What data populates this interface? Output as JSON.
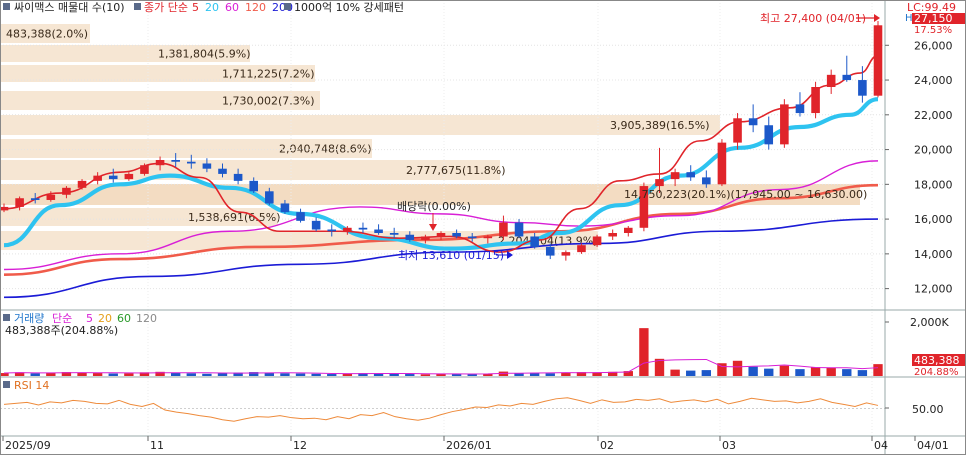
{
  "price_legend": {
    "symbol": "싸이맥스 매물대 수(10)",
    "ma_label": "종가 단순",
    "ma_periods": [
      {
        "label": "5",
        "color": "#e0242a"
      },
      {
        "label": "20",
        "color": "#2ec3f0"
      },
      {
        "label": "60",
        "color": "#d81fd6"
      },
      {
        "label": "120",
        "color": "#f05b4a"
      },
      {
        "label": "200",
        "color": "#1b1bd6"
      }
    ],
    "pattern_label": "1000억 10% 강세패턴"
  },
  "volume_legend": {
    "title": "거래량",
    "ma_label": "단순",
    "ma_periods": [
      {
        "label": "5",
        "color": "#d81fd6"
      },
      {
        "label": "20",
        "color": "#e6a11d"
      },
      {
        "label": "60",
        "color": "#2a9a2a"
      },
      {
        "label": "120",
        "color": "#8a8a8a"
      }
    ],
    "current_text": "483,388주(204.88%)"
  },
  "rsi_legend": {
    "title": "RSI 14"
  },
  "price_axis": {
    "ticks": [
      "26,000",
      "24,000",
      "22,000",
      "20,000",
      "18,000",
      "16,000",
      "14,000",
      "12,000"
    ],
    "lc_label": "LC:99.49",
    "h_label": "H",
    "current_price": "27,150",
    "current_change": "17.53%"
  },
  "volume_axis": {
    "top_label": "2,000K",
    "current_volume": "483,388",
    "current_ratio": "204.88%"
  },
  "rsi_axis": {
    "label": "50.00"
  },
  "date_axis": {
    "labels": [
      "2025/09",
      "11",
      "12",
      "2026/01",
      "02",
      "03",
      "04",
      "04/01"
    ]
  },
  "annotations": {
    "high": "최고 27,400 (04/01)",
    "low": "최저 13,610 (01/15)",
    "dividend": "배당락(0.00%)",
    "price_range": "14,750,223(20.1%)(17,945.00 ~ 16,630.00)"
  },
  "chart_data": [
    {
      "type": "candlestick",
      "name": "price",
      "ylim": [
        11000,
        27800
      ],
      "x_labels": [
        "2025/09",
        "11",
        "12",
        "2026/01",
        "02",
        "03",
        "04"
      ],
      "ohlc_sample": [
        [
          16500,
          16900,
          16400,
          16700
        ],
        [
          16700,
          17300,
          16500,
          17200
        ],
        [
          17200,
          17500,
          16900,
          17100
        ],
        [
          17100,
          17600,
          17000,
          17400
        ],
        [
          17400,
          17900,
          17200,
          17800
        ],
        [
          17800,
          18300,
          17700,
          18200
        ],
        [
          18200,
          18700,
          18000,
          18500
        ],
        [
          18500,
          18900,
          18100,
          18300
        ],
        [
          18300,
          18700,
          18200,
          18600
        ],
        [
          18600,
          19200,
          18500,
          19100
        ],
        [
          19100,
          19600,
          18800,
          19400
        ],
        [
          19400,
          19800,
          19000,
          19300
        ],
        [
          19300,
          19700,
          18900,
          19200
        ],
        [
          19200,
          19500,
          18700,
          18900
        ],
        [
          18900,
          19200,
          18400,
          18600
        ],
        [
          18600,
          18900,
          18000,
          18200
        ],
        [
          18200,
          18400,
          17500,
          17600
        ],
        [
          17600,
          17800,
          16800,
          16900
        ],
        [
          16900,
          17100,
          16300,
          16400
        ],
        [
          16400,
          16600,
          15800,
          15900
        ],
        [
          15900,
          16100,
          15300,
          15400
        ],
        [
          15400,
          15700,
          15000,
          15300
        ],
        [
          15300,
          15600,
          15100,
          15500
        ],
        [
          15500,
          15800,
          15200,
          15400
        ],
        [
          15400,
          15700,
          15100,
          15200
        ],
        [
          15200,
          15500,
          14900,
          15100
        ],
        [
          15100,
          15300,
          14700,
          14800
        ],
        [
          14800,
          15100,
          14600,
          15000
        ],
        [
          15000,
          15300,
          14800,
          15200
        ],
        [
          15200,
          15400,
          14900,
          15000
        ],
        [
          15000,
          15200,
          14700,
          14900
        ],
        [
          14900,
          15100,
          14600,
          15000
        ],
        [
          15000,
          16200,
          14800,
          15800
        ],
        [
          15800,
          16000,
          14900,
          15000
        ],
        [
          15000,
          15200,
          14300,
          14400
        ],
        [
          14400,
          14600,
          13700,
          13900
        ],
        [
          13900,
          14200,
          13610,
          14100
        ],
        [
          14100,
          14600,
          14000,
          14500
        ],
        [
          14500,
          15100,
          14400,
          15000
        ],
        [
          15000,
          15400,
          14800,
          15200
        ],
        [
          15200,
          15600,
          15000,
          15500
        ],
        [
          15500,
          18100,
          15300,
          17900
        ],
        [
          17900,
          20100,
          17500,
          18300
        ],
        [
          18300,
          18900,
          17900,
          18700
        ],
        [
          18700,
          19100,
          18200,
          18400
        ],
        [
          18400,
          18800,
          17800,
          18000
        ],
        [
          18000,
          20600,
          17900,
          20400
        ],
        [
          20400,
          22100,
          20000,
          21800
        ],
        [
          21800,
          22600,
          21000,
          21400
        ],
        [
          21400,
          21900,
          20000,
          20300
        ],
        [
          20300,
          22900,
          20100,
          22600
        ],
        [
          22600,
          23300,
          21900,
          22100
        ],
        [
          22100,
          23900,
          21800,
          23600
        ],
        [
          23600,
          24600,
          23200,
          24300
        ],
        [
          24300,
          25400,
          23900,
          24000
        ],
        [
          24000,
          24800,
          22700,
          23100
        ],
        [
          23100,
          27400,
          23000,
          27150
        ]
      ]
    },
    {
      "type": "bar",
      "name": "volume",
      "ylim": [
        0,
        2200000
      ],
      "values": [
        120000,
        150000,
        110000,
        130000,
        160000,
        140000,
        120000,
        100000,
        110000,
        150000,
        170000,
        130000,
        110000,
        90000,
        120000,
        140000,
        160000,
        130000,
        110000,
        100000,
        90000,
        80000,
        100000,
        120000,
        110000,
        90000,
        80000,
        70000,
        90000,
        100000,
        80000,
        90000,
        180000,
        120000,
        130000,
        110000,
        140000,
        160000,
        150000,
        170000,
        200000,
        1950000,
        700000,
        260000,
        220000,
        240000,
        520000,
        620000,
        380000,
        300000,
        420000,
        280000,
        360000,
        330000,
        280000,
        240000,
        483388
      ],
      "up": [
        true,
        true,
        false,
        true,
        true,
        true,
        true,
        false,
        true,
        true,
        true,
        false,
        false,
        false,
        false,
        false,
        false,
        false,
        false,
        false,
        false,
        false,
        true,
        false,
        false,
        false,
        false,
        true,
        true,
        false,
        false,
        true,
        true,
        false,
        false,
        false,
        true,
        true,
        true,
        true,
        true,
        true,
        true,
        true,
        false,
        false,
        true,
        true,
        false,
        false,
        true,
        false,
        true,
        true,
        false,
        false,
        true
      ]
    },
    {
      "type": "line",
      "name": "RSI 14",
      "ylim": [
        0,
        100
      ],
      "values": [
        58,
        60,
        62,
        57,
        63,
        61,
        66,
        64,
        60,
        59,
        66,
        58,
        54,
        60,
        47,
        43,
        40,
        36,
        33,
        28,
        25,
        30,
        34,
        33,
        36,
        32,
        30,
        31,
        28,
        34,
        30,
        38,
        36,
        42,
        34,
        30,
        27,
        31,
        38,
        44,
        48,
        53,
        52,
        57,
        55,
        60,
        58,
        64,
        69,
        71,
        66,
        60,
        67,
        62,
        63,
        68,
        66,
        69,
        62,
        65,
        67,
        63,
        68,
        59,
        64,
        70,
        67,
        64,
        65,
        61,
        64,
        69,
        62,
        58,
        54,
        61,
        56
      ]
    },
    {
      "type": "volume-profile",
      "name": "매물대",
      "labels": [
        "483,388(2.0%)",
        "1,381,804(5.9%)",
        "1,711,225(7.2%)",
        "1,730,002(7.3%)",
        "3,905,389(16.5%)",
        "2,040,748(8.6%)",
        "2,777,675(11.8%)",
        "4,750,223(20.1%)",
        "1,538,691(6.5%)",
        "2,204,704(13.9%)"
      ],
      "percents": [
        2.0,
        5.9,
        7.2,
        7.3,
        16.5,
        8.6,
        11.8,
        20.1,
        6.5,
        13.9
      ]
    }
  ]
}
